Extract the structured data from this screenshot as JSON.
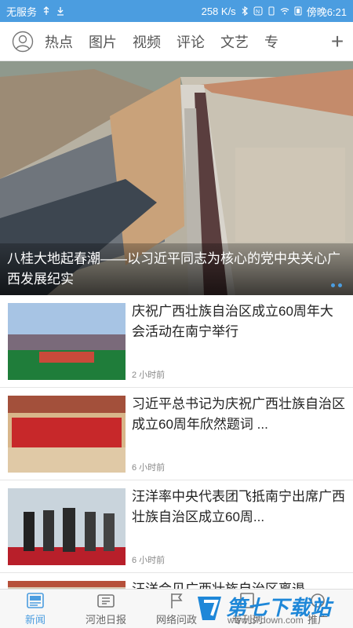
{
  "statusbar": {
    "carrier": "无服务",
    "speed": "258 K/s",
    "time": "傍晚6:21"
  },
  "topnav": {
    "tabs": [
      "热点",
      "图片",
      "视频",
      "评论",
      "文艺",
      "专"
    ],
    "add_label": "+"
  },
  "hero": {
    "caption": "八桂大地起春潮——以习近平同志为核心的党中央关心广西发展纪实"
  },
  "news": [
    {
      "title": "庆祝广西壮族自治区成立60周年大会活动在南宁举行",
      "time": "2 小时前"
    },
    {
      "title": "习近平总书记为庆祝广西壮族自治区成立60周年欣然题词 ...",
      "time": "6 小时前"
    },
    {
      "title": "汪洋率中央代表团飞抵南宁出席广西壮族自治区成立60周...",
      "time": "6 小时前"
    },
    {
      "title": "汪洋会见广西壮族自治区离退",
      "time": ""
    }
  ],
  "bottomnav": [
    {
      "label": "新闻",
      "icon": "news-icon",
      "active": true
    },
    {
      "label": "河池日报",
      "icon": "newspaper-icon",
      "active": false
    },
    {
      "label": "网络问政",
      "icon": "flag-icon",
      "active": false
    },
    {
      "label": "专刊列",
      "icon": "magazine-icon",
      "active": false
    },
    {
      "label": "推广",
      "icon": "promo-icon",
      "active": false
    }
  ],
  "watermark": {
    "text": "第七下载站",
    "url": "www.d7down.com"
  },
  "colors": {
    "accent": "#4b9de0",
    "caption_text": "#ffffff"
  }
}
